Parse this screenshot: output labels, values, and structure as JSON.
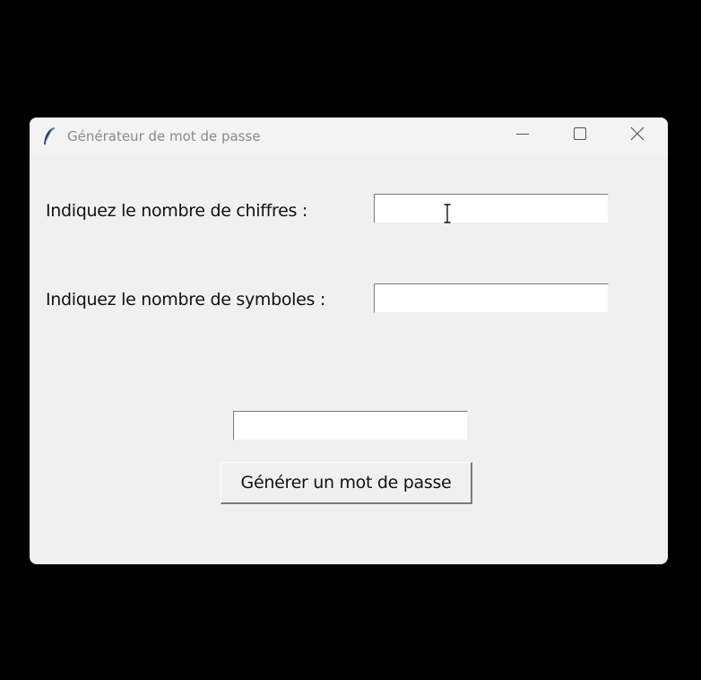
{
  "window": {
    "title": "Générateur de mot de passe",
    "controls": {
      "minimize": "minimize-icon",
      "maximize": "maximize-icon",
      "close": "close-icon"
    },
    "app_icon": "feather-icon"
  },
  "form": {
    "digits_label": "Indiquez le nombre de chiffres :",
    "digits_value": "",
    "symbols_label": "Indiquez le nombre de symboles :",
    "symbols_value": "",
    "result_value": "",
    "generate_label": "Générer un mot de passe"
  },
  "colors": {
    "window_bg": "#f0f0f0",
    "desktop_bg": "#000000",
    "title_text": "#8a8a8a"
  }
}
